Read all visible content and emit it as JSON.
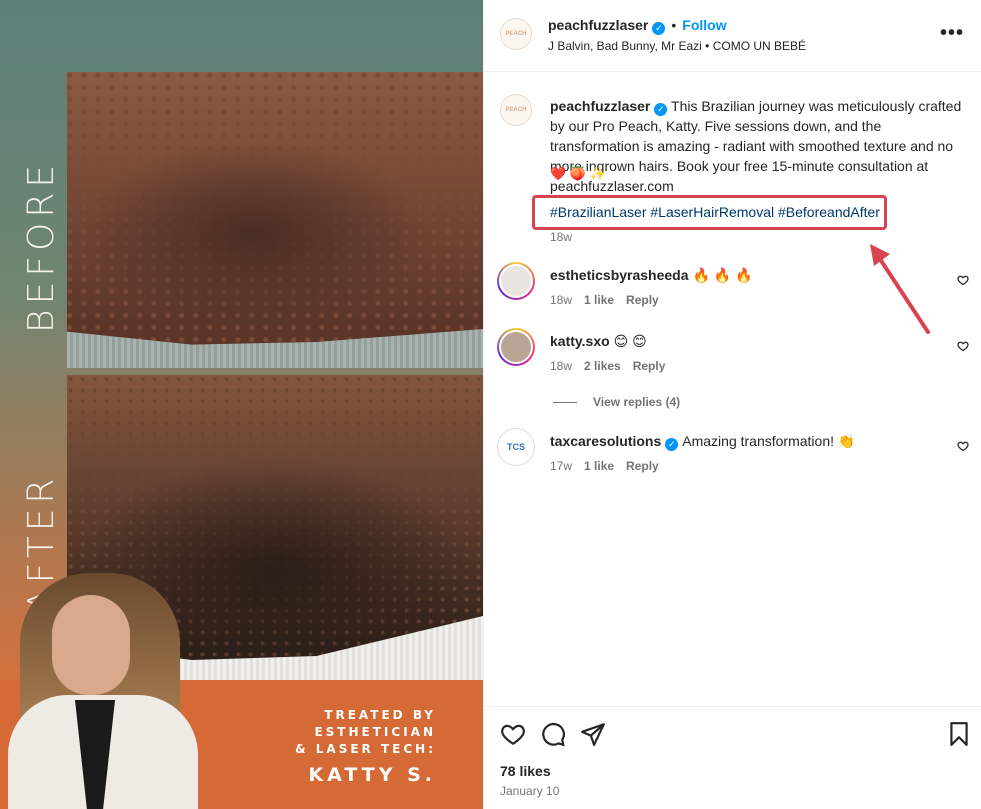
{
  "media": {
    "before_label": "BEFORE",
    "after_label": "AFTER",
    "treated_lines": [
      "TREATED BY",
      "ESTHETICIAN",
      "& LASER TECH:"
    ],
    "treated_name": "KATTY S.",
    "colors": {
      "band": "#d66a37",
      "top": "#5c7f78"
    }
  },
  "header": {
    "username": "peachfuzzlaser",
    "follow_label": "Follow",
    "audio": "J Balvin, Bad Bunny, Mr Eazi • COMO UN BEBÉ",
    "more_icon": "more-horizontal-icon"
  },
  "caption": {
    "username": "peachfuzzlaser",
    "text": "This Brazilian journey was meticulously crafted by our Pro Peach, Katty. Five sessions down, and the transformation is amazing - radiant with smoothed texture and no more ingrown hairs. Book your free 15-minute consultation at peachfuzzlaser.com",
    "emojis": "❤️ 🍑 ✨",
    "hashtags": "#BrazilianLaser #LaserHairRemoval #BeforeandAfter",
    "time": "18w",
    "highlight_color": "#d8434e"
  },
  "comments": [
    {
      "username": "estheticsbyrasheeda",
      "text": "🔥 🔥 🔥",
      "time": "18w",
      "likes": "1 like",
      "reply": "Reply",
      "verified": false
    },
    {
      "username": "katty.sxo",
      "text": "😊 😊",
      "time": "18w",
      "likes": "2 likes",
      "reply": "Reply",
      "verified": false
    },
    {
      "username": "taxcaresolutions",
      "text": "Amazing transformation! 👏",
      "time": "17w",
      "likes": "1 like",
      "reply": "Reply",
      "verified": true
    }
  ],
  "view_replies": "View replies (4)",
  "footer": {
    "likes": "78 likes",
    "date": "January 10"
  }
}
